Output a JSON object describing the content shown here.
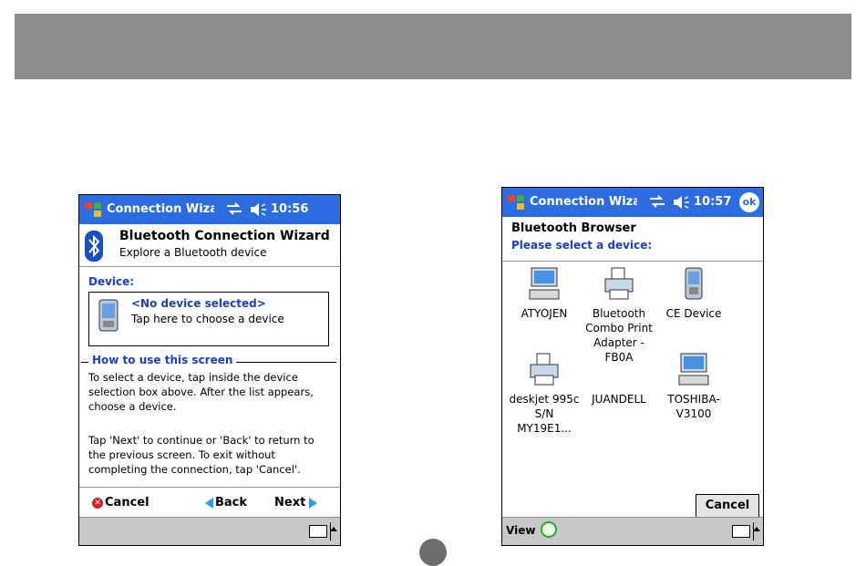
{
  "screen1": {
    "title": "Connection Wizarc",
    "time": "10:56",
    "wizard_title": "Bluetooth Connection Wizard",
    "wizard_subtitle": "Explore a Bluetooth device",
    "device_label": "Device:",
    "device_value": "<No device selected>",
    "device_hint": "Tap here to choose a device",
    "howto_title": "How to use this screen",
    "para1": "To select a device, tap inside the device selection box above. After the list appears, choose a device.",
    "para2": "Tap 'Next' to continue or 'Back' to return to the previous screen. To exit without completing the connection, tap 'Cancel'.",
    "cancel_label": "Cancel",
    "back_label": "Back",
    "next_label": "Next"
  },
  "screen2": {
    "title": "Connection Wizarc",
    "time": "10:57",
    "ok_label": "ok",
    "browser_title": "Bluetooth Browser",
    "browser_subtitle": "Please select a device:",
    "devices": [
      {
        "label": "ATYOJEN",
        "icon": "computer-icon"
      },
      {
        "label": "Bluetooth Combo Print Adapter - FB0A",
        "icon": "printer-icon"
      },
      {
        "label": "CE Device",
        "icon": "pda-icon"
      },
      {
        "label": "deskjet 995c S/N MY19E1...",
        "icon": "printer-icon"
      },
      {
        "label": "JUANDELL",
        "icon": "none"
      },
      {
        "label": "TOSHIBA-V3100",
        "icon": "computer-icon"
      }
    ],
    "cancel_label": "Cancel",
    "view_label": "View"
  },
  "colors": {
    "titlebar": "#2c6be0",
    "link_blue": "#1a3ec8",
    "band_gray": "#8c8c8c",
    "menubar_gray": "#c8c8c8"
  }
}
